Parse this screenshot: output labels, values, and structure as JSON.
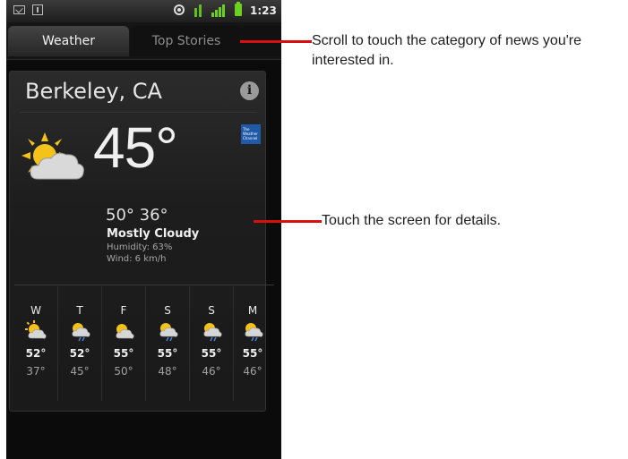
{
  "status_bar": {
    "time": "1:23"
  },
  "tabs": {
    "weather": "Weather",
    "top_stories": "Top Stories"
  },
  "weather": {
    "city": "Berkeley, CA",
    "info_label": "i",
    "provider_logo_text": "The Weather Channel",
    "temperature": "45°",
    "high_low": "50°  36°",
    "condition": "Mostly Cloudy",
    "humidity": "Humidity: 63%",
    "wind": "Wind: 6 km/h",
    "forecast": [
      {
        "day": "W",
        "hi": "52°",
        "lo": "37°",
        "icon": "partly-cloudy-icon"
      },
      {
        "day": "T",
        "hi": "52°",
        "lo": "45°",
        "icon": "rain-icon"
      },
      {
        "day": "F",
        "hi": "55°",
        "lo": "50°",
        "icon": "partly-cloudy-icon"
      },
      {
        "day": "S",
        "hi": "55°",
        "lo": "48°",
        "icon": "rain-icon"
      },
      {
        "day": "S",
        "hi": "55°",
        "lo": "46°",
        "icon": "rain-icon"
      },
      {
        "day": "M",
        "hi": "55°",
        "lo": "46°",
        "icon": "rain-icon"
      }
    ]
  },
  "callouts": {
    "tabs": "Scroll to touch the category of news you're interested in.",
    "details": "Touch the screen for details."
  },
  "colors": {
    "callout": "#d80f0f",
    "sun": "#f5c21b",
    "tab_active": "#3a3a3a"
  }
}
